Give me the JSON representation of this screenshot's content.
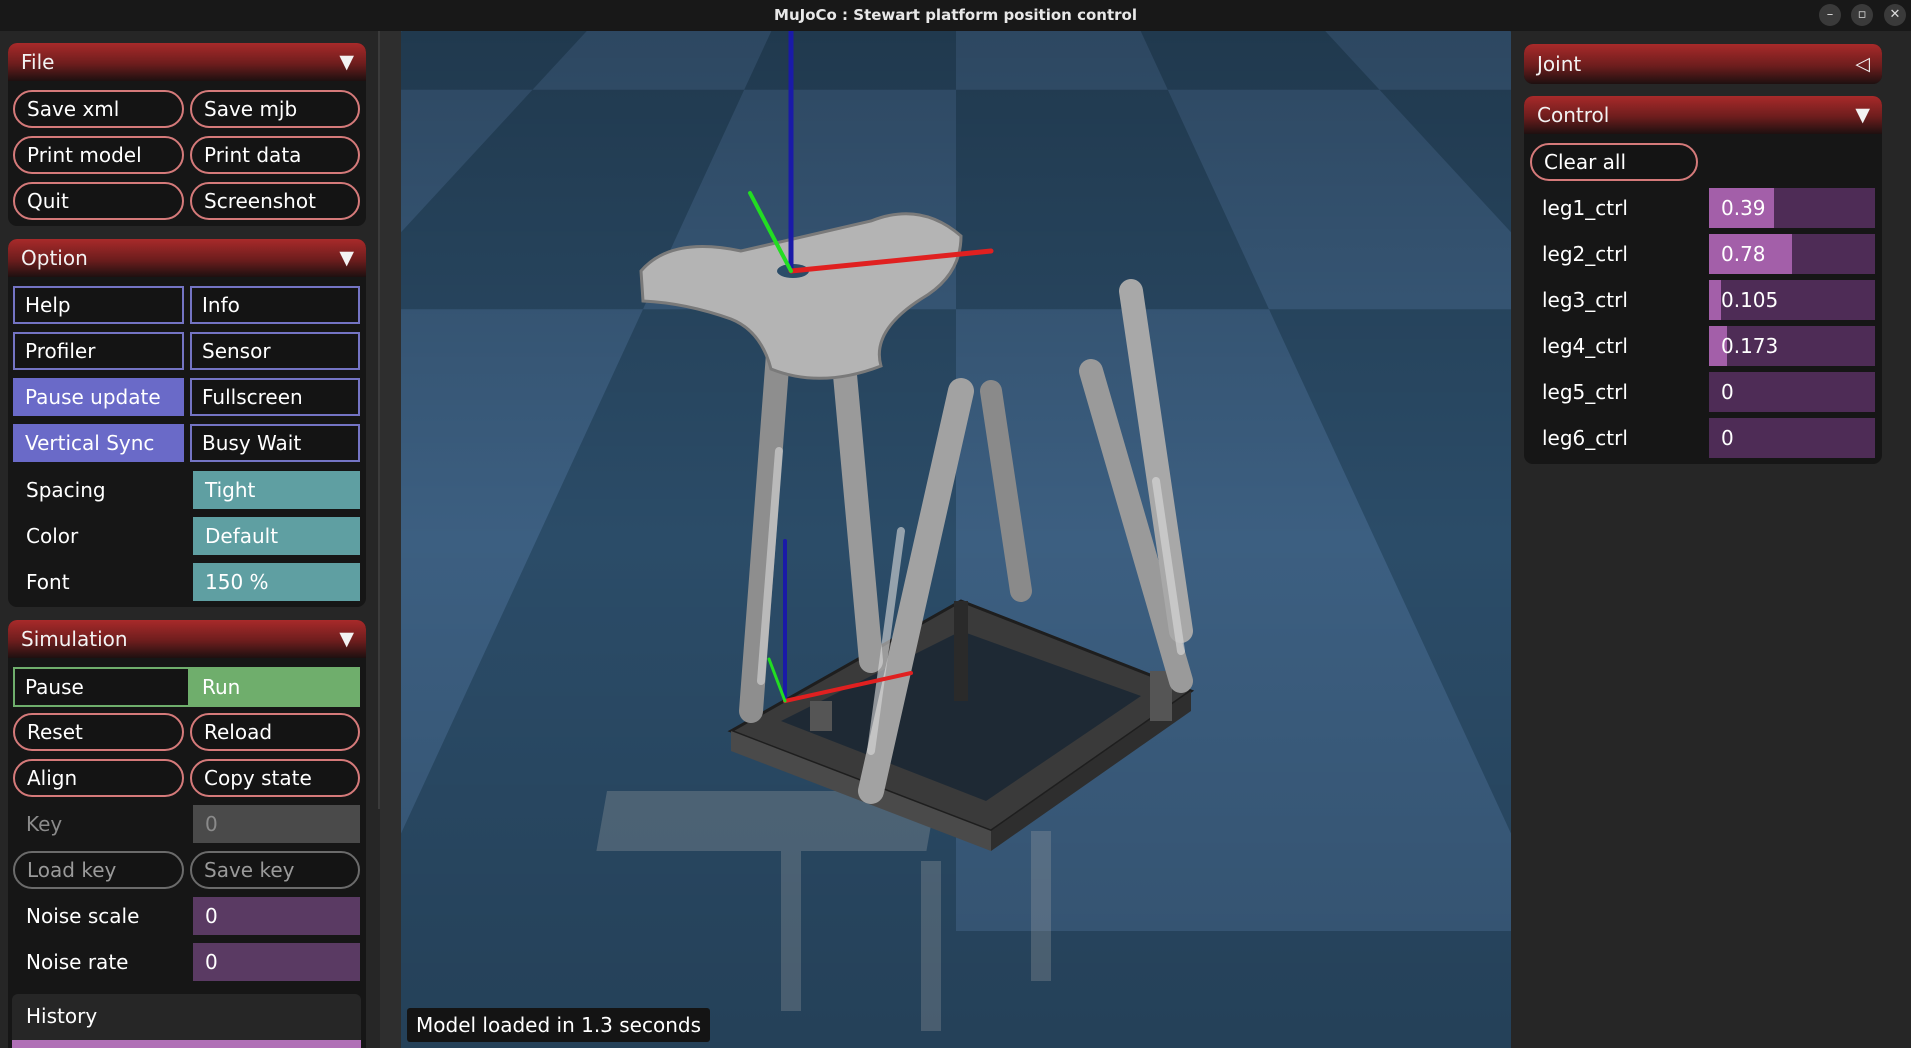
{
  "window": {
    "title": "MuJoCo : Stewart platform position control",
    "minimize_glyph": "–",
    "maximize_glyph": "▫",
    "close_glyph": "✕"
  },
  "file_panel": {
    "title": "File",
    "toggle": "▼",
    "buttons": [
      "Save xml",
      "Save mjb",
      "Print model",
      "Print data",
      "Quit",
      "Screenshot"
    ]
  },
  "option_panel": {
    "title": "Option",
    "toggle": "▼",
    "checks": [
      {
        "label": "Help",
        "on": false
      },
      {
        "label": "Info",
        "on": false
      },
      {
        "label": "Profiler",
        "on": false
      },
      {
        "label": "Sensor",
        "on": false
      },
      {
        "label": "Pause update",
        "on": true
      },
      {
        "label": "Fullscreen",
        "on": false
      },
      {
        "label": "Vertical Sync",
        "on": true
      },
      {
        "label": "Busy Wait",
        "on": false
      }
    ],
    "spacing": {
      "label": "Spacing",
      "value": "Tight"
    },
    "color": {
      "label": "Color",
      "value": "Default"
    },
    "font": {
      "label": "Font",
      "value": "150 %"
    }
  },
  "simulation_panel": {
    "title": "Simulation",
    "toggle": "▼",
    "pause_label": "Pause",
    "run_label": "Run",
    "selected": "Run",
    "buttons": [
      "Reset",
      "Reload",
      "Align",
      "Copy state"
    ],
    "key": {
      "label": "Key",
      "value": "0"
    },
    "load_key": "Load key",
    "save_key": "Save key",
    "noise_scale": {
      "label": "Noise scale",
      "value": "0"
    },
    "noise_rate": {
      "label": "Noise rate",
      "value": "0"
    },
    "history_label": "History"
  },
  "joint_panel": {
    "title": "Joint",
    "toggle": "◁"
  },
  "control_panel": {
    "title": "Control",
    "toggle": "▼",
    "clear_all": "Clear all",
    "controls": [
      {
        "label": "leg1_ctrl",
        "value": "0.39",
        "fraction": 0.39
      },
      {
        "label": "leg2_ctrl",
        "value": "0.78",
        "fraction": 0.5
      },
      {
        "label": "leg3_ctrl",
        "value": "0.105",
        "fraction": 0.07
      },
      {
        "label": "leg4_ctrl",
        "value": "0.173",
        "fraction": 0.11
      },
      {
        "label": "leg5_ctrl",
        "value": "0",
        "fraction": 0
      },
      {
        "label": "leg6_ctrl",
        "value": "0",
        "fraction": 0
      }
    ]
  },
  "viewport": {
    "status": "Model loaded in 1.3 seconds",
    "floor_dark": "#2b4c68",
    "floor_light": "#4a7096",
    "axis_x_color": "#e02020",
    "axis_y_color": "#22dd22",
    "axis_z_color": "#1a1aa8",
    "model_color": "#9c9c9c",
    "frame_color": "#3a3a3a"
  }
}
